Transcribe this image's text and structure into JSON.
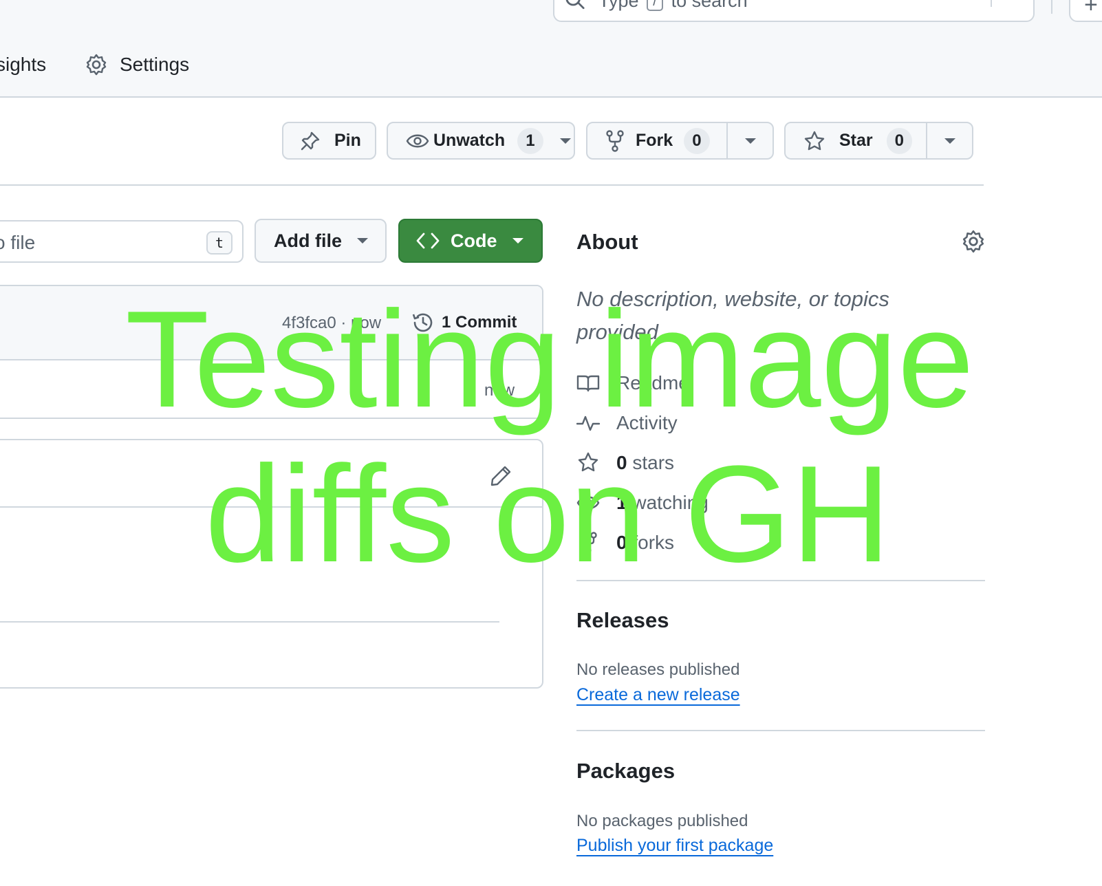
{
  "header": {
    "search_prefix": "Type",
    "search_key": "/",
    "search_suffix": "to search",
    "plus_label": "+"
  },
  "repo_tabs": {
    "insights_partial": "sights",
    "settings": "Settings"
  },
  "actions": {
    "pin": "Pin",
    "unwatch": "Unwatch",
    "watch_count": "1",
    "fork": "Fork",
    "fork_count": "0",
    "star": "Star",
    "star_count": "0"
  },
  "file_nav": {
    "goto_placeholder_partial": "o file",
    "goto_shortcut": "t",
    "add_file": "Add file",
    "code": "Code"
  },
  "commit": {
    "sha_time": "4f3fca0 · now",
    "commit_count": "1 Commit",
    "file_time": "now"
  },
  "about": {
    "title": "About",
    "description": "No description, website, or topics provided.",
    "readme": "Readme",
    "activity": "Activity",
    "stars_count": "0",
    "stars_label": "stars",
    "watching_count": "1",
    "watching_label": "watching",
    "forks_count": "0",
    "forks_label": "forks"
  },
  "releases": {
    "title": "Releases",
    "empty_text": "No releases published",
    "link": "Create a new release"
  },
  "packages": {
    "title": "Packages",
    "empty_text": "No packages published",
    "link": "Publish your first package"
  },
  "overlay": {
    "line1": "Testing image",
    "line2": "diffs on GH",
    "color": "#6cf042"
  },
  "colors": {
    "code_button": "#3a8a40",
    "link": "#0969da",
    "border": "#d0d7de"
  }
}
